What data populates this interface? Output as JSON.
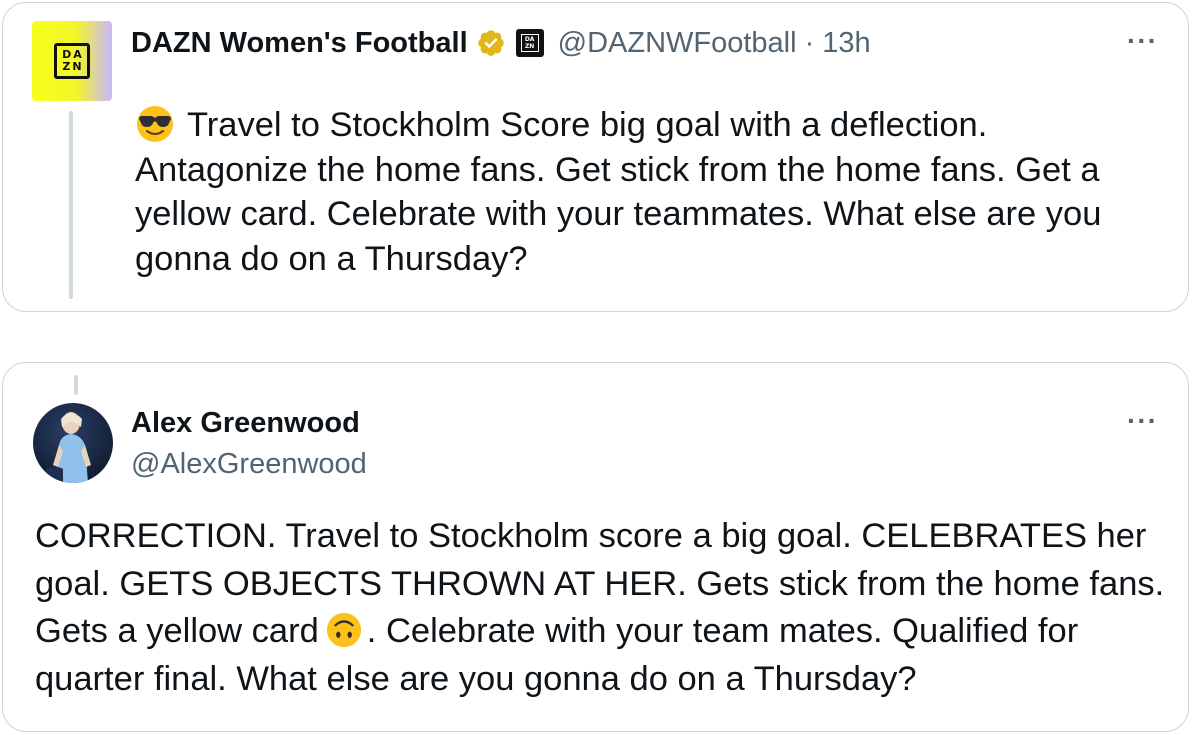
{
  "tweet1": {
    "author_name": "DAZN Women's Football",
    "handle": "@DAZNWFootball",
    "separator": "·",
    "time": "13h",
    "avatar_logo_top": "DA",
    "avatar_logo_bottom": "ZN",
    "affiliate_badge_top": "DA",
    "affiliate_badge_bottom": "ZN",
    "emoji": "smiling-face-with-sunglasses",
    "text": "Travel to Stockholm Score big goal with a deflection. Antagonize the home fans. Get stick from the home fans. Get a yellow card. Celebrate with your teammates. What else are you gonna do on a Thursday?",
    "more_label": "···"
  },
  "tweet2": {
    "author_name": "Alex Greenwood",
    "handle": "@AlexGreenwood",
    "text_part1": "CORRECTION. Travel to Stockholm score a big goal. CELEBRATES her goal. GETS OBJECTS THROWN AT HER. Gets stick from the home fans. Gets a yellow card",
    "emoji": "upside-down-face",
    "text_part2": ". Celebrate with your team mates. Qualified for quarter final. What else are you gonna do on a Thursday?",
    "more_label": "···"
  },
  "colors": {
    "text_primary": "#0f1419",
    "text_secondary": "#536471",
    "border": "#cfd4d8",
    "verified_gold": "#e2b719",
    "thread_line": "#cfd9de"
  }
}
